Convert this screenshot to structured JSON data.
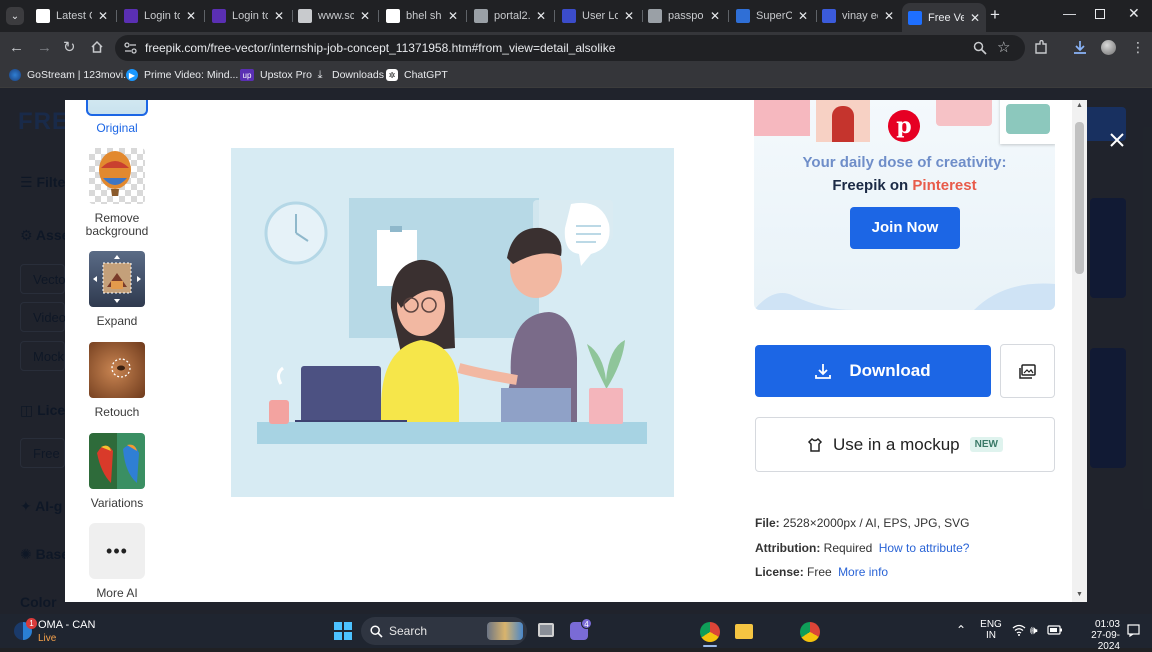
{
  "browser": {
    "tabs": [
      {
        "label": "Latest C",
        "favicon": "news-icon",
        "color": "#ffffff"
      },
      {
        "label": "Login to",
        "favicon": "upstox-icon",
        "color": "#5a2fb3"
      },
      {
        "label": "Login to",
        "favicon": "upstox-icon",
        "color": "#5a2fb3"
      },
      {
        "label": "www.sc",
        "favicon": "bars-icon",
        "color": "#c8cacd"
      },
      {
        "label": "bhel sha",
        "favicon": "google-icon",
        "color": "#ffffff"
      },
      {
        "label": "portal2.",
        "favicon": "page-icon",
        "color": "#9aa0a6"
      },
      {
        "label": "User Log",
        "favicon": "portal-icon",
        "color": "#3b4cca"
      },
      {
        "label": "passpor",
        "favicon": "page-icon",
        "color": "#9aa0a6"
      },
      {
        "label": "SuperC",
        "favicon": "c-icon",
        "color": "#2f6fd6"
      },
      {
        "label": "vinay ed",
        "favicon": "mail-icon",
        "color": "#3b5bdb"
      },
      {
        "label": "Free Vec",
        "favicon": "freepik-icon",
        "color": "#1e6fff"
      }
    ],
    "url": "freepik.com/free-vector/internship-job-concept_11371958.htm#from_view=detail_alsolike",
    "bookmarks": [
      {
        "label": "GoStream | 123movi...",
        "icon": "gostream-icon"
      },
      {
        "label": "Prime Video: Mind...",
        "icon": "prime-icon"
      },
      {
        "label": "Upstox Pro",
        "icon": "upstox-icon"
      },
      {
        "label": "Downloads",
        "icon": "download-icon"
      },
      {
        "label": "ChatGPT",
        "icon": "chatgpt-icon"
      }
    ]
  },
  "sidebar_tools": [
    {
      "label": "Original",
      "selected": true
    },
    {
      "label": "Remove background"
    },
    {
      "label": "Expand"
    },
    {
      "label": "Retouch"
    },
    {
      "label": "Variations"
    },
    {
      "label": "More AI"
    }
  ],
  "background_page": {
    "logo": "FRE",
    "menu": [
      "Filte",
      "Asse",
      "Vecto",
      "Video",
      "Mock",
      "Lice",
      "Free",
      "AI-g",
      "Base",
      "Color"
    ]
  },
  "promo": {
    "line1": "Your daily dose of creativity:",
    "line2_prefix": "Freepik on",
    "line2_brand": "Pinterest",
    "button": "Join Now",
    "line1_color": "#6f8ec9",
    "brand_color": "#e85b4a"
  },
  "actions": {
    "download": "Download",
    "mockup": "Use in a mockup",
    "mockup_badge": "NEW"
  },
  "info": {
    "file_label": "File:",
    "file_value": "2528×2000px / AI, EPS, JPG, SVG",
    "attribution_label": "Attribution:",
    "attribution_value": "Required",
    "attribution_link": "How to attribute?",
    "license_label": "License:",
    "license_value": "Free",
    "license_link": "More info"
  },
  "taskbar": {
    "weather_title": "OMA - CAN",
    "weather_sub": "Live",
    "search": "Search",
    "lang_top": "ENG",
    "lang_bottom": "IN",
    "time": "01:03",
    "date": "27-09-2024",
    "teams_badge": "4",
    "weather_badge": "1"
  },
  "colors": {
    "accent": "#1c66e5",
    "link": "#2a64d6"
  }
}
